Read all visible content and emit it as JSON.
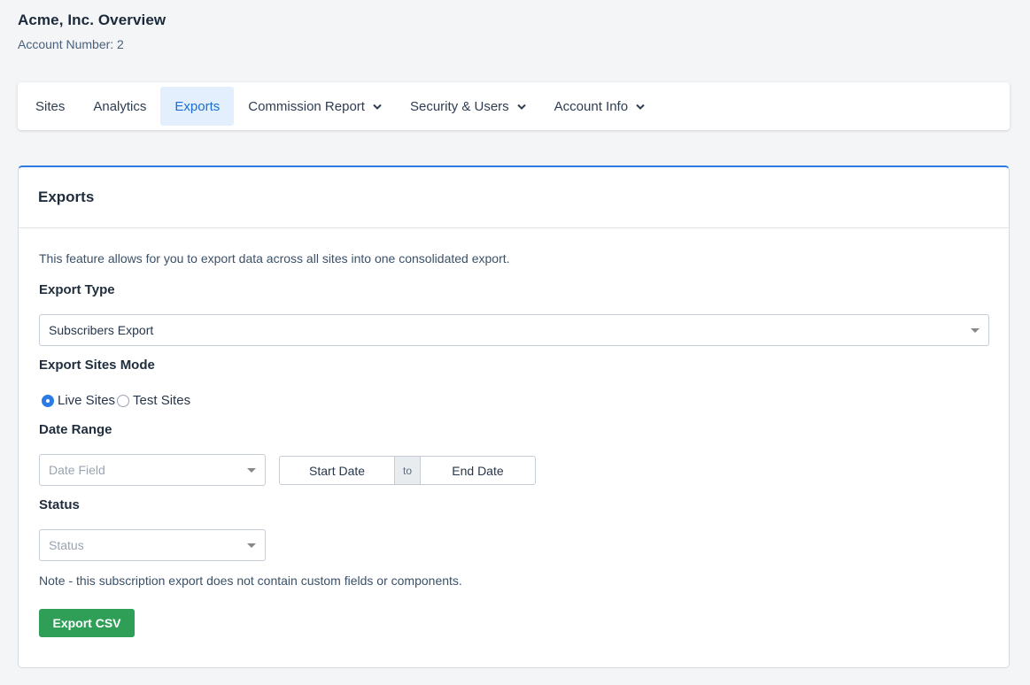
{
  "header": {
    "title": "Acme, Inc. Overview",
    "account_number": "Account Number: 2"
  },
  "nav": {
    "items": [
      {
        "label": "Sites",
        "active": false,
        "dropdown": false
      },
      {
        "label": "Analytics",
        "active": false,
        "dropdown": false
      },
      {
        "label": "Exports",
        "active": true,
        "dropdown": false
      },
      {
        "label": "Commission Report",
        "active": false,
        "dropdown": true
      },
      {
        "label": "Security & Users",
        "active": false,
        "dropdown": true
      },
      {
        "label": "Account Info",
        "active": false,
        "dropdown": true
      }
    ]
  },
  "exports": {
    "heading": "Exports",
    "description": "This feature allows for you to export data across all sites into one consolidated export.",
    "export_type": {
      "label": "Export Type",
      "value": "Subscribers Export"
    },
    "sites_mode": {
      "label": "Export Sites Mode",
      "options": [
        {
          "label": "Live Sites",
          "checked": true
        },
        {
          "label": "Test Sites",
          "checked": false
        }
      ]
    },
    "date_range": {
      "label": "Date Range",
      "field_placeholder": "Date Field",
      "start": "Start Date",
      "separator": "to",
      "end": "End Date"
    },
    "status": {
      "label": "Status",
      "placeholder": "Status"
    },
    "note": "Note - this subscription export does not contain custom fields or components.",
    "button_label": "Export CSV"
  },
  "colors": {
    "accent": "#2c7be5",
    "active_tab_bg": "#e3effc",
    "button_green": "#2f9e57"
  },
  "icons": [
    "chevron-down-icon",
    "caret-down-icon"
  ]
}
